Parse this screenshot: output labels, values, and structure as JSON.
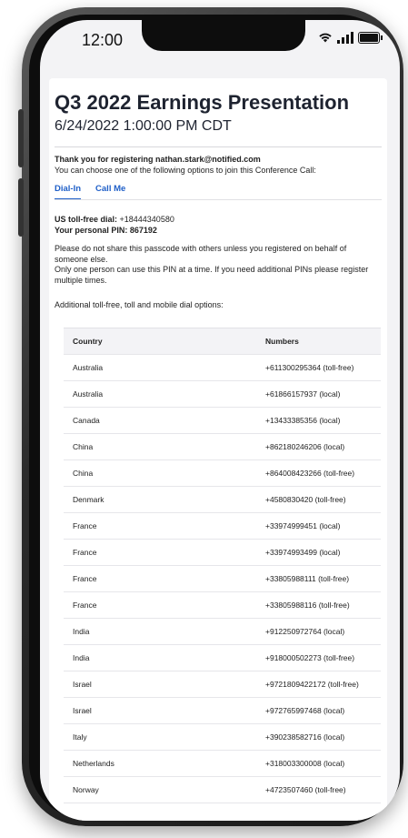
{
  "status": {
    "time": "12:00"
  },
  "header": {
    "title": "Q3 2022 Earnings Presentation",
    "subtitle": "6/24/2022  1:00:00 PM CDT"
  },
  "intro": {
    "thanks_prefix": "Thank you for registering ",
    "email": "nathan.stark@notified.com",
    "choose_text": "You can choose one of the following options to join this Conference Call:"
  },
  "tabs": [
    {
      "label": "Dial-In"
    },
    {
      "label": "Call Me"
    }
  ],
  "dial_in": {
    "tollfree_label": "US toll-free dial: ",
    "tollfree_number": "+18444340580",
    "pin_label": "Your personal PIN: ",
    "pin_value": "867192",
    "note_line1": "Please do not share this passcode with others unless you registered on behalf of someone else.",
    "note_line2": "Only one person can use this PIN at a time. If you need additional PINs please register multiple times.",
    "additional": "Additional toll-free, toll and mobile dial options:"
  },
  "table": {
    "headers": [
      "Country",
      "Numbers"
    ],
    "rows": [
      [
        "Australia",
        "+611300295364 (toll-free)"
      ],
      [
        "Australia",
        "+61866157937 (local)"
      ],
      [
        "Canada",
        "+13433385356 (local)"
      ],
      [
        "China",
        "+862180246206 (local)"
      ],
      [
        "China",
        "+864008423266 (toll-free)"
      ],
      [
        "Denmark",
        "+4580830420 (toll-free)"
      ],
      [
        "France",
        "+33974999451 (local)"
      ],
      [
        "France",
        "+33974993499 (local)"
      ],
      [
        "France",
        "+33805988111 (toll-free)"
      ],
      [
        "France",
        "+33805988116 (toll-free)"
      ],
      [
        "India",
        "+912250972764 (local)"
      ],
      [
        "India",
        "+918000502273 (toll-free)"
      ],
      [
        "Israel",
        "+9721809422172 (toll-free)"
      ],
      [
        "Israel",
        "+972765997468 (local)"
      ],
      [
        "Italy",
        "+390238582716 (local)"
      ],
      [
        "Netherlands",
        "+318003300008 (local)"
      ],
      [
        "Norway",
        "+4723507460 (toll-free)"
      ]
    ]
  }
}
